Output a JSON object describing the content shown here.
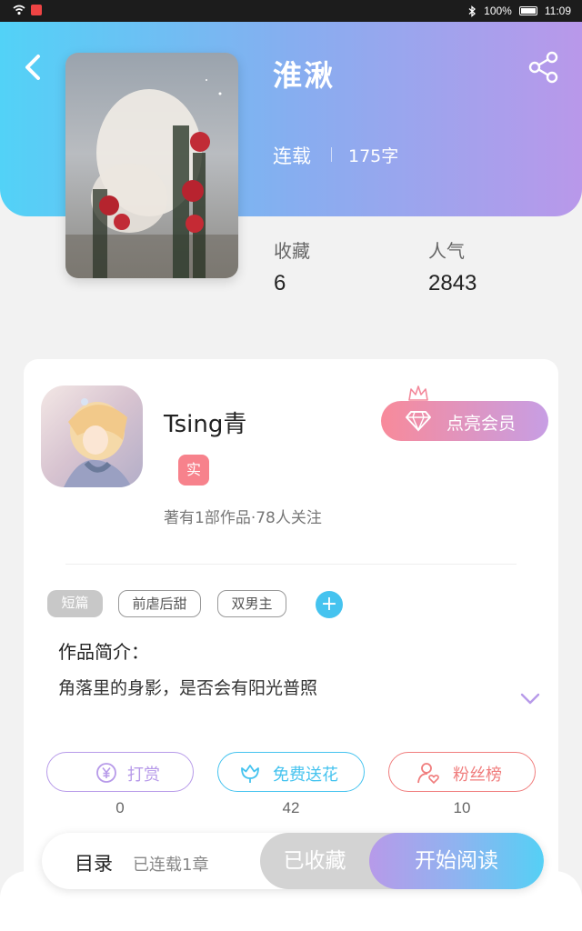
{
  "status_bar": {
    "battery": "100%",
    "time": "11:09"
  },
  "book": {
    "title": "淮湫",
    "status": "连载",
    "word_count": "175字"
  },
  "stats": {
    "favorites_label": "收藏",
    "favorites_value": "6",
    "popularity_label": "人气",
    "popularity_value": "2843"
  },
  "author": {
    "name": "Tsing青",
    "badge": "实",
    "info": "著有1部作品·78人关注"
  },
  "vip": {
    "label": "点亮会员"
  },
  "tags": [
    "短篇",
    "前虐后甜",
    "双男主"
  ],
  "intro": {
    "title": "作品简介：",
    "text": "角落里的身影，是否会有阳光普照"
  },
  "actions": [
    {
      "label": "打赏",
      "count": "0",
      "color": "#b79ae9"
    },
    {
      "label": "免费送花",
      "count": "42",
      "color": "#45c3ef"
    },
    {
      "label": "粉丝榜",
      "count": "10",
      "color": "#f07d7d"
    }
  ],
  "bottom_bar": {
    "toc_label": "目录",
    "toc_status": "已连载1章",
    "collected_label": "已收藏",
    "read_label": "开始阅读"
  }
}
